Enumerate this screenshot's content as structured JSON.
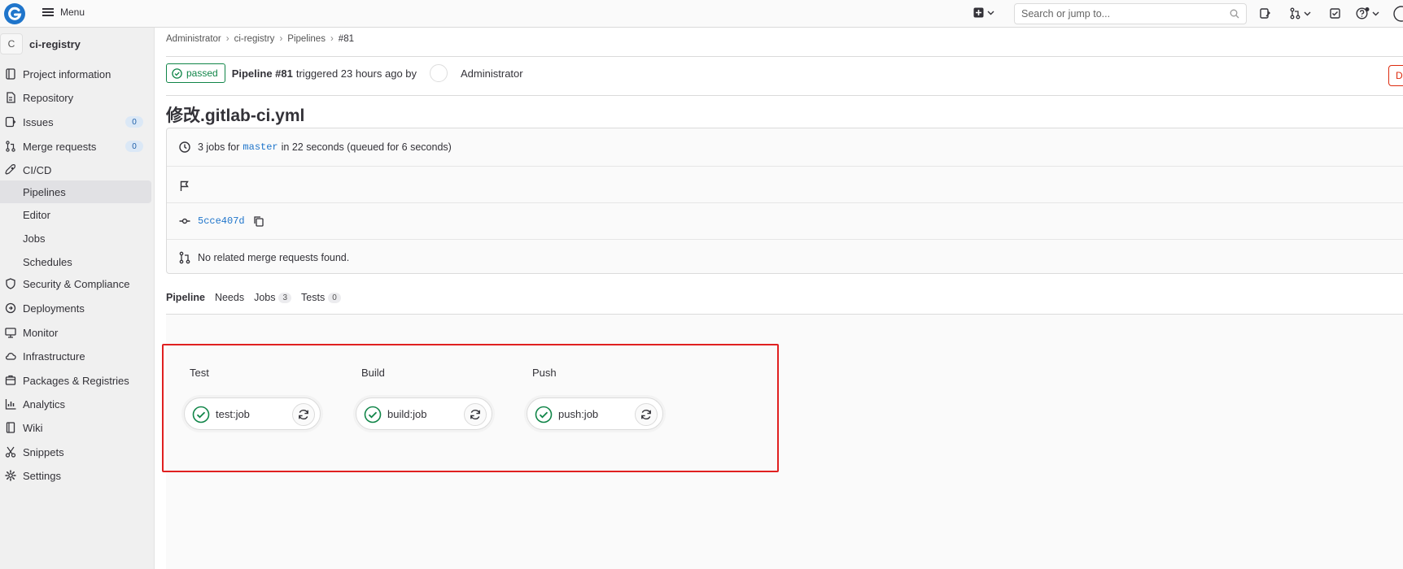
{
  "topbar": {
    "menu_label": "Menu",
    "search_placeholder": "Search or jump to..."
  },
  "project": {
    "avatar_letter": "C",
    "name": "ci-registry"
  },
  "sidebar": {
    "items": [
      {
        "label": "Project information",
        "icon": "project-info-icon"
      },
      {
        "label": "Repository",
        "icon": "repository-icon"
      },
      {
        "label": "Issues",
        "icon": "issues-icon",
        "badge": "0"
      },
      {
        "label": "Merge requests",
        "icon": "merge-request-icon",
        "badge": "0"
      },
      {
        "label": "CI/CD",
        "icon": "rocket-icon"
      },
      {
        "label": "Security & Compliance",
        "icon": "shield-icon"
      },
      {
        "label": "Deployments",
        "icon": "deployments-icon"
      },
      {
        "label": "Monitor",
        "icon": "monitor-icon"
      },
      {
        "label": "Infrastructure",
        "icon": "cloud-icon"
      },
      {
        "label": "Packages & Registries",
        "icon": "package-icon"
      },
      {
        "label": "Analytics",
        "icon": "chart-icon"
      },
      {
        "label": "Wiki",
        "icon": "book-icon"
      },
      {
        "label": "Snippets",
        "icon": "scissors-icon"
      },
      {
        "label": "Settings",
        "icon": "gear-icon"
      }
    ],
    "cicd_sub": [
      "Pipelines",
      "Editor",
      "Jobs",
      "Schedules"
    ],
    "active_sub": "Pipelines"
  },
  "breadcrumb": [
    "Administrator",
    "ci-registry",
    "Pipelines",
    "#81"
  ],
  "pipeline": {
    "status": "passed",
    "title": "Pipeline #81",
    "triggered": "triggered 23 hours ago by",
    "user": "Administrator",
    "delete_label": "De",
    "commit_title": "修改.gitlab-ci.yml"
  },
  "info": {
    "jobs_prefix": "3 jobs for",
    "branch": "master",
    "jobs_suffix": "in 22 seconds (queued for 6 seconds)",
    "commit_sha": "5cce407d",
    "mr_text": "No related merge requests found."
  },
  "tabs": [
    {
      "label": "Pipeline",
      "count": ""
    },
    {
      "label": "Needs",
      "count": ""
    },
    {
      "label": "Jobs",
      "count": "3"
    },
    {
      "label": "Tests",
      "count": "0"
    }
  ],
  "stages": [
    {
      "title": "Test",
      "job": "test:job",
      "status": "success"
    },
    {
      "title": "Build",
      "job": "build:job",
      "status": "success"
    },
    {
      "title": "Push",
      "job": "push:job",
      "status": "success"
    }
  ],
  "colors": {
    "success": "#108548",
    "highlight": "#e02020",
    "link": "#1f75cb",
    "danger": "#dd2b0e"
  }
}
